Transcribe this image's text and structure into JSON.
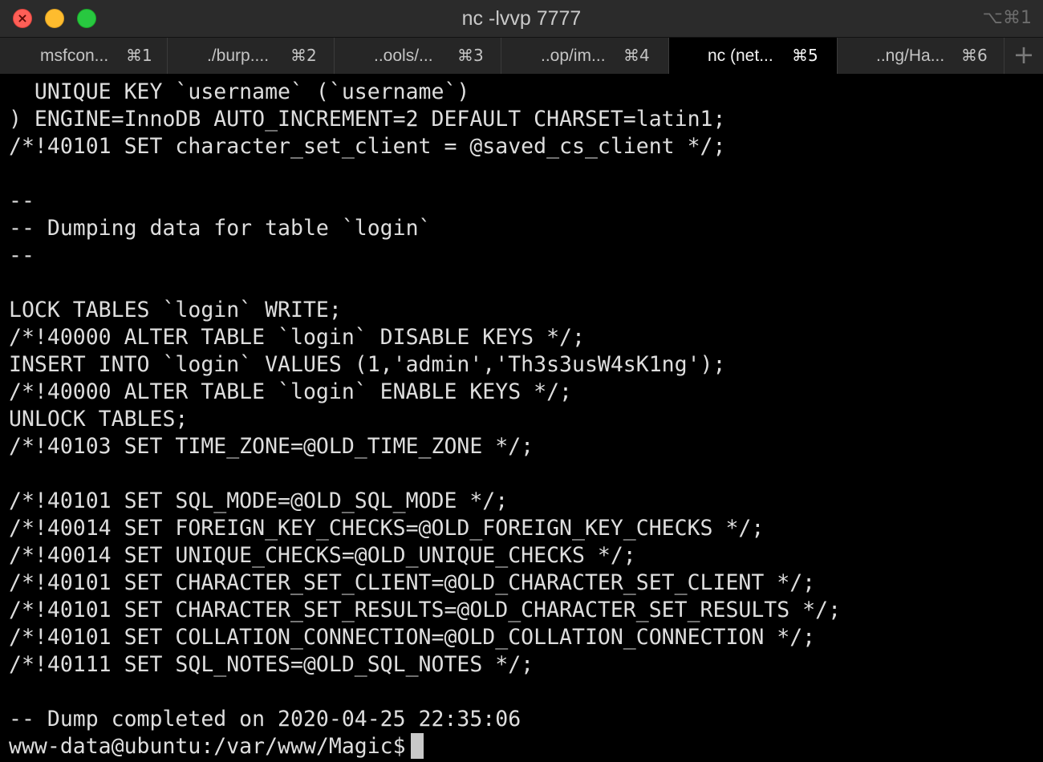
{
  "window": {
    "title": "nc -lvvp 7777",
    "shortcut": "⌥⌘1"
  },
  "tabs": [
    {
      "label": "msfcon...",
      "key": "⌘1",
      "active": false
    },
    {
      "label": "./burp....",
      "key": "⌘2",
      "active": false
    },
    {
      "label": "..ools/...",
      "key": "⌘3",
      "active": false
    },
    {
      "label": "..op/im...",
      "key": "⌘4",
      "active": false
    },
    {
      "label": "nc (net...",
      "key": "⌘5",
      "active": true
    },
    {
      "label": "..ng/Ha...",
      "key": "⌘6",
      "active": false
    }
  ],
  "new_tab_label": "+",
  "terminal": {
    "lines": [
      "  UNIQUE KEY `username` (`username`)",
      ") ENGINE=InnoDB AUTO_INCREMENT=2 DEFAULT CHARSET=latin1;",
      "/*!40101 SET character_set_client = @saved_cs_client */;",
      "",
      "--",
      "-- Dumping data for table `login`",
      "--",
      "",
      "LOCK TABLES `login` WRITE;",
      "/*!40000 ALTER TABLE `login` DISABLE KEYS */;",
      "INSERT INTO `login` VALUES (1,'admin','Th3s3usW4sK1ng');",
      "/*!40000 ALTER TABLE `login` ENABLE KEYS */;",
      "UNLOCK TABLES;",
      "/*!40103 SET TIME_ZONE=@OLD_TIME_ZONE */;",
      "",
      "/*!40101 SET SQL_MODE=@OLD_SQL_MODE */;",
      "/*!40014 SET FOREIGN_KEY_CHECKS=@OLD_FOREIGN_KEY_CHECKS */;",
      "/*!40014 SET UNIQUE_CHECKS=@OLD_UNIQUE_CHECKS */;",
      "/*!40101 SET CHARACTER_SET_CLIENT=@OLD_CHARACTER_SET_CLIENT */;",
      "/*!40101 SET CHARACTER_SET_RESULTS=@OLD_CHARACTER_SET_RESULTS */;",
      "/*!40101 SET COLLATION_CONNECTION=@OLD_COLLATION_CONNECTION */;",
      "/*!40111 SET SQL_NOTES=@OLD_SQL_NOTES */;",
      "",
      "-- Dump completed on 2020-04-25 22:35:06"
    ],
    "prompt": "www-data@ubuntu:/var/www/Magic$"
  }
}
